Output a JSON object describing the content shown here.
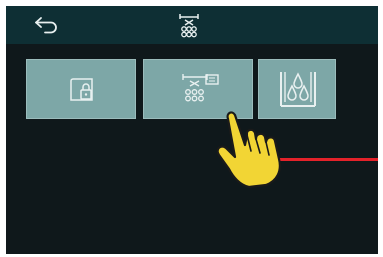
{
  "topbar": {
    "back_icon": "back-arrow-icon",
    "title_icon": "shower-head-icon"
  },
  "tiles": [
    {
      "icon": "door-lock-icon",
      "selected": false
    },
    {
      "icon": "shower-spray-icon",
      "selected": true
    },
    {
      "icon": "rinse-drops-icon",
      "selected": false
    }
  ],
  "overlay": {
    "pointer_icon": "tap-hand-icon",
    "line_color": "#e4222a"
  },
  "colors": {
    "screen_bg": "#0f181b",
    "topbar_bg": "#0e2f34",
    "tile_bg": "#7da7a7",
    "icon_fg": "#e8f0f0"
  }
}
